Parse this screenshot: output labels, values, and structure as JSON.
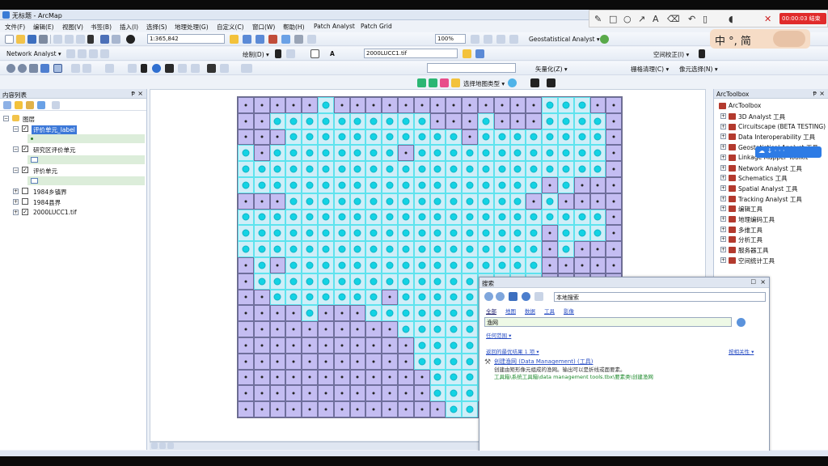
{
  "window": {
    "title": "无标题 - ArcMap"
  },
  "menu": [
    "文件(F)",
    "编辑(E)",
    "视图(V)",
    "书签(B)",
    "插入(I)",
    "选择(S)",
    "地理处理(G)",
    "自定义(C)",
    "窗口(W)",
    "帮助(H)",
    "Patch Analyst",
    "Patch Grid"
  ],
  "toolbar1": {
    "scale": "1:365,842",
    "zoom": "100%",
    "geostat_label": "Geostatistical Analyst ▾"
  },
  "toolbar2": {
    "network_label": "Network Analyst ▾",
    "draw_label": "绘制(D) ▾",
    "text_tool": "A",
    "raster_value": "2000LUCC1.tif",
    "georef_label": "空间校正(I) ▾"
  },
  "toolbar3": {
    "vectorize_label": "矢量化(Z) ▾",
    "raster_clean_label": "栅格清理(C) ▾",
    "cell_select_label": "像元选择(N) ▾",
    "select_layer_label": "选择地图类型 ▾"
  },
  "toc": {
    "title": "内容列表",
    "layers_root": "图层",
    "layers": [
      {
        "name": "评价单元_label",
        "checked": true,
        "selected": true
      },
      {
        "name": "研究区评价单元",
        "checked": true
      },
      {
        "name": "评价单元",
        "checked": true
      },
      {
        "name": "1984乡镇界",
        "checked": false
      },
      {
        "name": "1984县界",
        "checked": false
      },
      {
        "name": "2000LUCC1.tif",
        "checked": true
      }
    ]
  },
  "arctoolbox": {
    "title": "ArcToolbox",
    "root": "ArcToolbox",
    "items": [
      "3D Analyst 工具",
      "Circuitscape (BETA TESTING)",
      "Data Interoperability 工具",
      "Geostatistical Analyst 工具",
      "Linkage Mapper Toolkit",
      "Network Analyst 工具",
      "Schematics 工具",
      "Spatial Analyst 工具",
      "Tracking Analyst 工具",
      "编辑工具",
      "地理编码工具",
      "多维工具",
      "分析工具",
      "服务器工具",
      "空间统计工具"
    ]
  },
  "search": {
    "title": "搜索",
    "scope": "本地搜索",
    "tabs": [
      "全部",
      "地图",
      "数据",
      "工具",
      "影像"
    ],
    "query": "渔网",
    "any_extent": "任何范围 ▾",
    "result_count": "返回的最优结果 1 项 ▾",
    "sort": "按相关性 ▾",
    "result_title": "创建渔网 (Data Management) (工具)",
    "result_desc": "创建由矩形像元组成的渔网。输出可以是折线或面要素。",
    "result_path": "工具箱\\系统工具箱\\data management tools.tbx\\要素类\\创建渔网"
  },
  "overlay": {
    "timer": "00:00:03 结束",
    "ime": "中 °, 简",
    "cloud_label": "↓ · · ·"
  },
  "map_grid": {
    "cols": 24,
    "rows": 20,
    "cells": [
      "pppppcpppppppppppppcccpp",
      "ppccccccccccpppcpppccccp",
      "pppcccccccccccpccccccccp",
      "cpccccccccpccccccccccccp",
      "cccccccccccccccccccccccp",
      "cccccccccccccccccccpcppp",
      "pppcccccccccccccccpcpppp",
      "cccccccccccccccccccccccp",
      "cccccccccccccccccccpcccp",
      "cccccccccccccccccccpcppp",
      "pcpccccccccccccccccpppp",
      "pccccccccccccccccccpppp",
      "ppcccccccpcccccccccpppp",
      "ppppcpppccccccccccpppp",
      "ppppppppppcccccccpppp",
      "pppppppppppcccccpppp",
      "pppppppppppcccccpppp",
      "ppppppppppppcccccpppp",
      "ppppppppppppcccccpppp",
      "pppppppppppppccpppcp"
    ]
  }
}
